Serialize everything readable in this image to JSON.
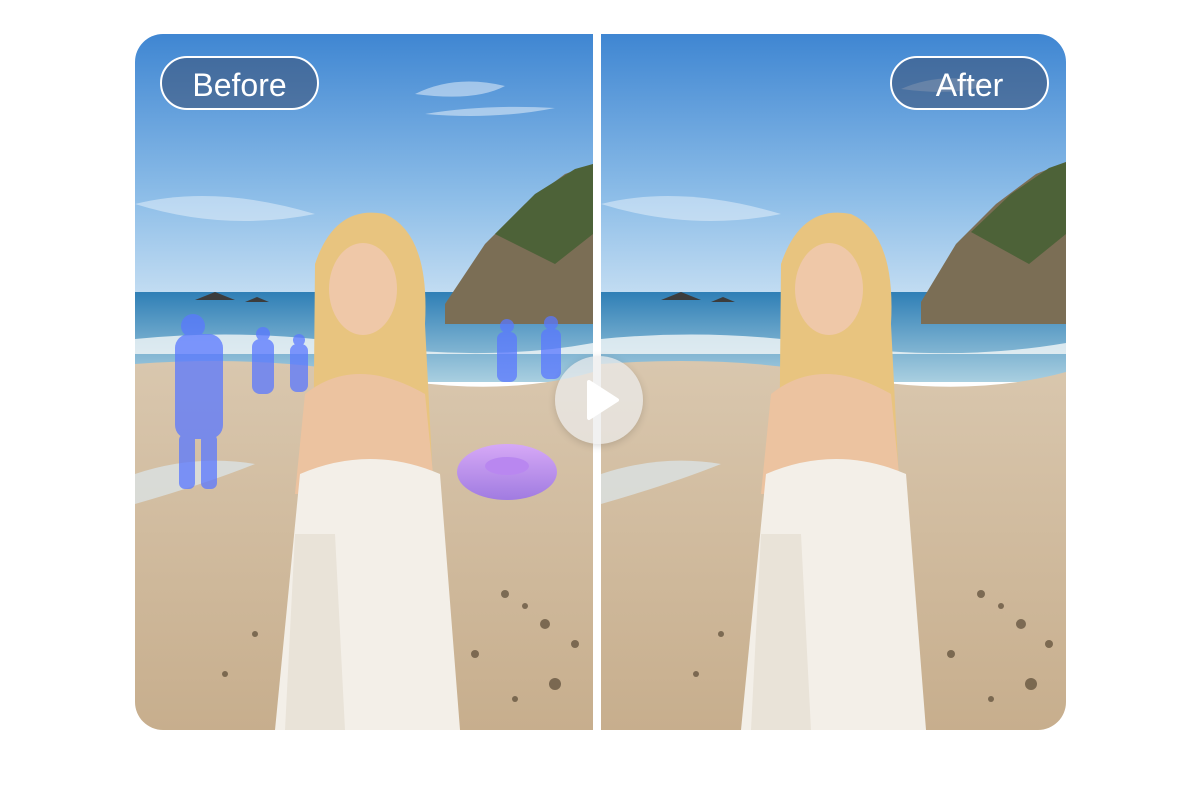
{
  "comparison": {
    "before_label": "Before",
    "after_label": "After",
    "play_icon": "play-icon"
  },
  "colors": {
    "label_background": "rgba(60,80,115,0.55)",
    "highlight": "#6a7fff",
    "ring": "#c48cf2"
  }
}
